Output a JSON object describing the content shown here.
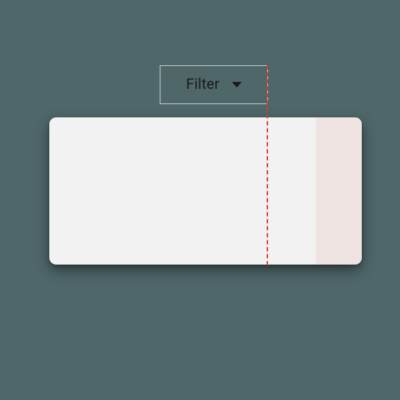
{
  "filter": {
    "label": "Filter"
  }
}
